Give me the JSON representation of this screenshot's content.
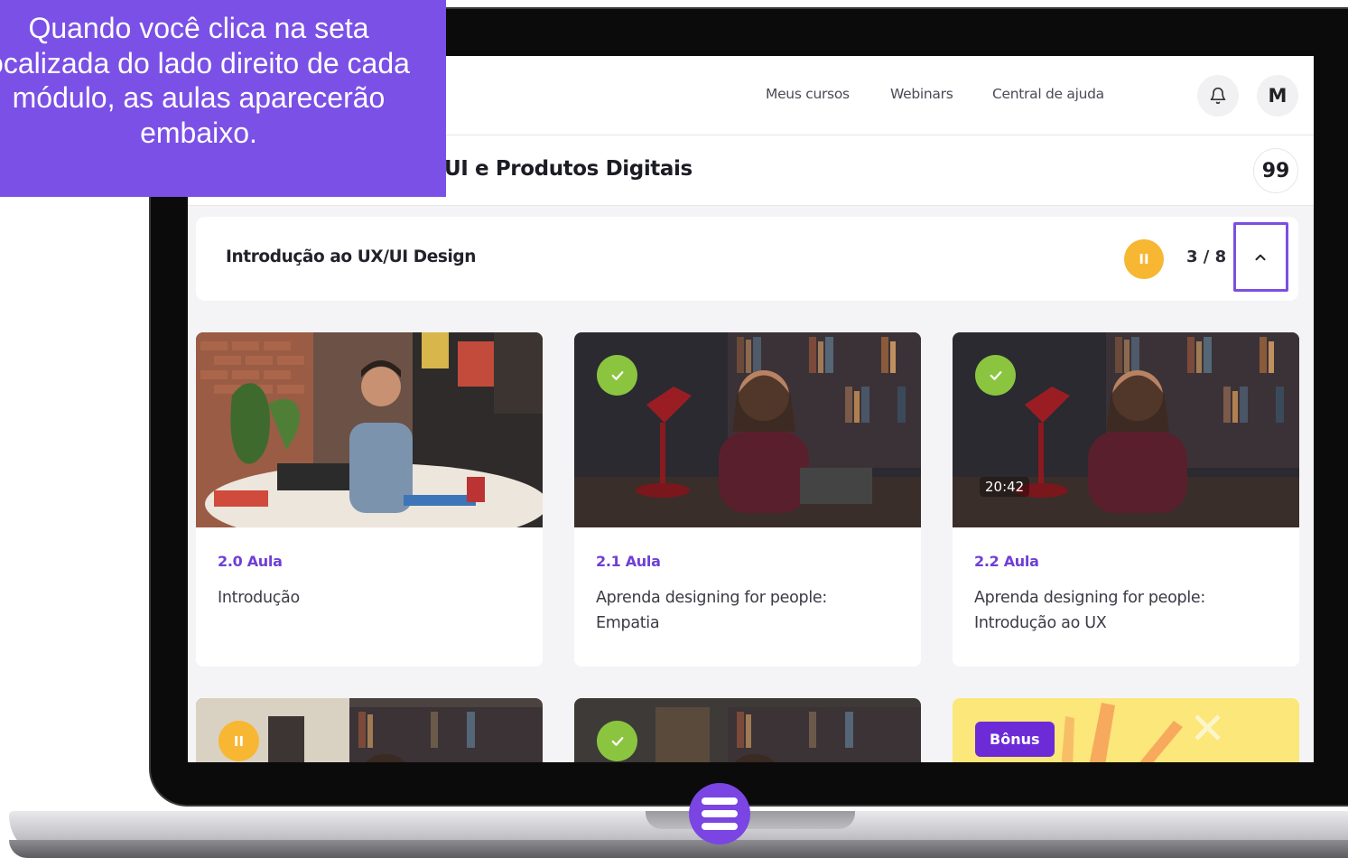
{
  "tooltip": {
    "text": "Quando você clica na seta ocalizada do lado direito de cada módulo, as aulas aparecerão embaixo."
  },
  "topnav": {
    "links": [
      "Meus cursos",
      "Webinars",
      "Central de ajuda"
    ],
    "avatar_initial": "M",
    "bell_icon": "bell-icon"
  },
  "course": {
    "title": "UI e Produtos Digitais",
    "quote_icon": "99"
  },
  "module": {
    "title": "Introdução ao UX/UI Design",
    "status_icon": "II",
    "progress": "3 / 8",
    "toggle_icon": "chevron-up-icon"
  },
  "lessons": [
    {
      "subtitle": "2.0 Aula",
      "title": "Introdução",
      "status": "",
      "duration": ""
    },
    {
      "subtitle": "2.1 Aula",
      "title": "Aprenda designing for people: Empatia",
      "status": "completed",
      "duration": ""
    },
    {
      "subtitle": "2.2 Aula",
      "title": "Aprenda designing for people: Introdução ao UX",
      "status": "completed",
      "duration": "20:42"
    }
  ],
  "next_row": {
    "card1_status": "II",
    "card3_badge": "Bônus"
  },
  "colors": {
    "accent": "#7b50e6",
    "lesson_label": "#6f3fd6",
    "completed": "#8bc540",
    "in_progress": "#f7b733"
  }
}
